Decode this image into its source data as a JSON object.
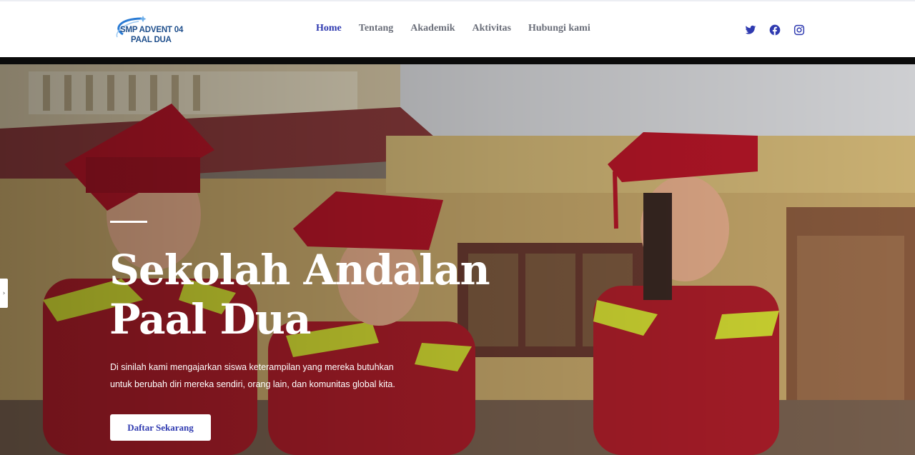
{
  "logo": {
    "line1": "SMP ADVENT 04",
    "line2": "PAAL DUA"
  },
  "nav": {
    "items": [
      {
        "label": "Home",
        "active": true
      },
      {
        "label": "Tentang"
      },
      {
        "label": "Akademik"
      },
      {
        "label": "Aktivitas"
      },
      {
        "label": "Hubungi kami"
      }
    ]
  },
  "social": {
    "icons": [
      "twitter-icon",
      "facebook-icon",
      "instagram-icon"
    ],
    "color": "#2f3ab0"
  },
  "hero": {
    "title_line1": "Sekolah Andalan",
    "title_line2": "Paal Dua",
    "description": "Di sinilah kami mengajarkan siswa keterampilan yang mereka butuhkan untuk berubah diri mereka sendiri, orang lain, dan komunitas global kita.",
    "cta_label": "Daftar Sekarang"
  },
  "colors": {
    "accent": "#2f3ab0",
    "nav_text": "#6b6f7a",
    "logo": "#1f4f8c"
  }
}
